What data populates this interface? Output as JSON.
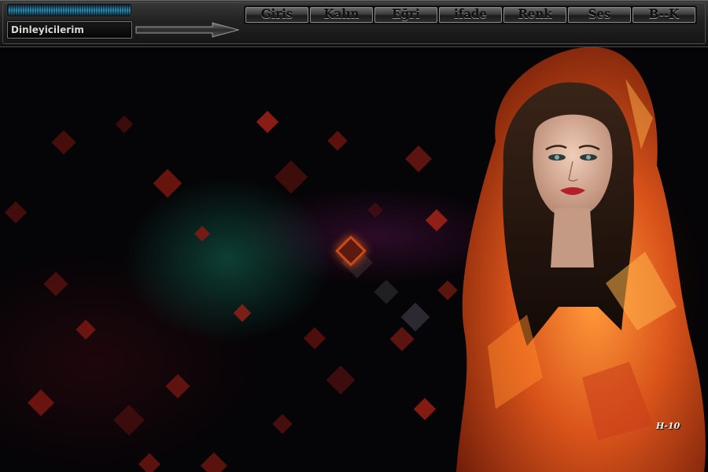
{
  "toolbar": {
    "listeners_label": "Dinleyicilerim",
    "buttons": [
      {
        "id": "giris",
        "label": "Giris"
      },
      {
        "id": "kalin",
        "label": "Kalın"
      },
      {
        "id": "egri",
        "label": "Eğri"
      },
      {
        "id": "ifade",
        "label": "ifade"
      },
      {
        "id": "renk",
        "label": "Renk"
      },
      {
        "id": "ses",
        "label": "Ses"
      },
      {
        "id": "b-k",
        "label": "B--K"
      }
    ]
  },
  "artwork": {
    "subject": "woman-in-orange-hood",
    "signature": "H-10"
  },
  "colors": {
    "toolbar_bg": "#222222",
    "meter_accent": "#2f8fb5",
    "hood_orange": "#e0621a",
    "tile_red": "#8a1a12"
  }
}
